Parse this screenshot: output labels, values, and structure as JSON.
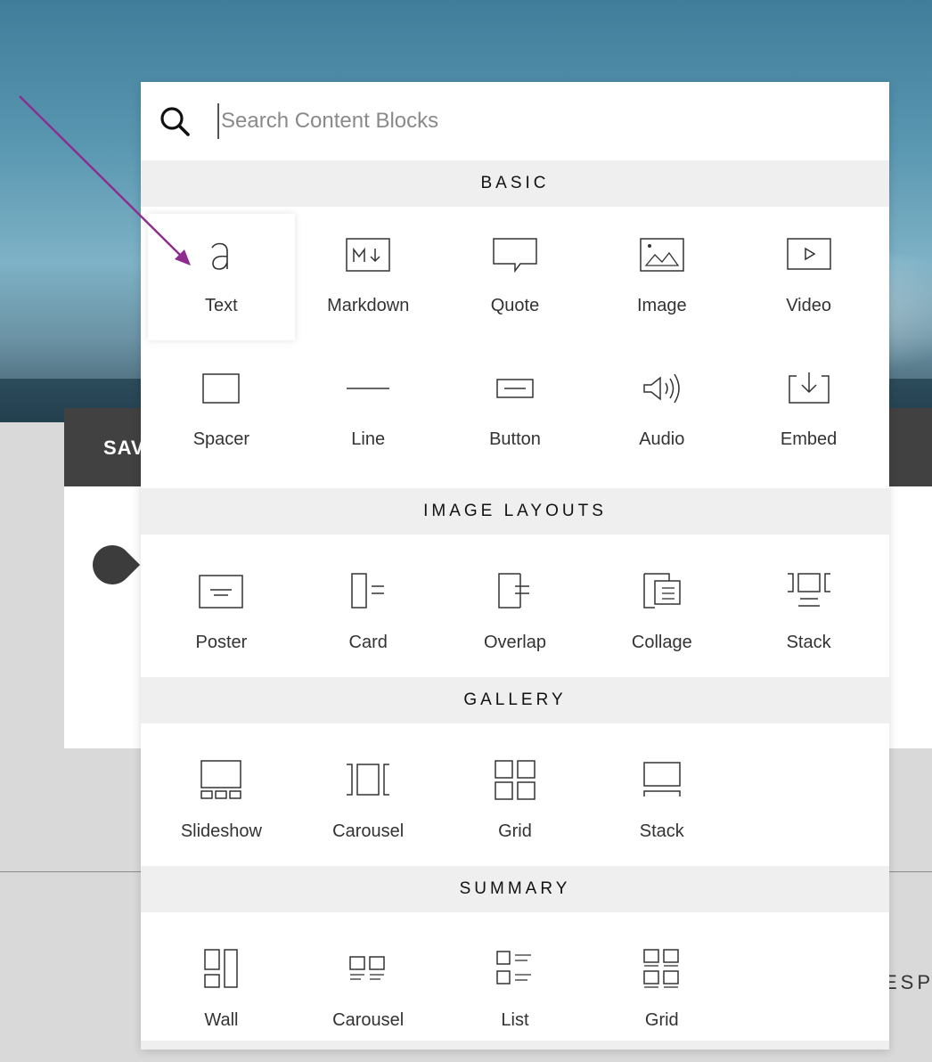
{
  "background": {
    "bar_text": "SAV",
    "right_text": "ESPA"
  },
  "search": {
    "placeholder": "Search Content Blocks",
    "value": ""
  },
  "sections": {
    "basic": {
      "title": "BASIC",
      "items": [
        {
          "label": "Text",
          "icon": "text-icon"
        },
        {
          "label": "Markdown",
          "icon": "markdown-icon"
        },
        {
          "label": "Quote",
          "icon": "quote-icon"
        },
        {
          "label": "Image",
          "icon": "image-icon"
        },
        {
          "label": "Video",
          "icon": "video-icon"
        },
        {
          "label": "Spacer",
          "icon": "spacer-icon"
        },
        {
          "label": "Line",
          "icon": "line-icon"
        },
        {
          "label": "Button",
          "icon": "button-icon"
        },
        {
          "label": "Audio",
          "icon": "audio-icon"
        },
        {
          "label": "Embed",
          "icon": "embed-icon"
        }
      ]
    },
    "image_layouts": {
      "title": "IMAGE LAYOUTS",
      "items": [
        {
          "label": "Poster",
          "icon": "poster-icon"
        },
        {
          "label": "Card",
          "icon": "card-icon"
        },
        {
          "label": "Overlap",
          "icon": "overlap-icon"
        },
        {
          "label": "Collage",
          "icon": "collage-icon"
        },
        {
          "label": "Stack",
          "icon": "stack-icon"
        }
      ]
    },
    "gallery": {
      "title": "GALLERY",
      "items": [
        {
          "label": "Slideshow",
          "icon": "slideshow-icon"
        },
        {
          "label": "Carousel",
          "icon": "carousel-icon"
        },
        {
          "label": "Grid",
          "icon": "grid-icon"
        },
        {
          "label": "Stack",
          "icon": "stack-gallery-icon"
        }
      ]
    },
    "summary": {
      "title": "SUMMARY",
      "items": [
        {
          "label": "Wall",
          "icon": "wall-icon"
        },
        {
          "label": "Carousel",
          "icon": "summary-carousel-icon"
        },
        {
          "label": "List",
          "icon": "list-icon"
        },
        {
          "label": "Grid",
          "icon": "summary-grid-icon"
        }
      ]
    }
  },
  "colors": {
    "annotation_arrow": "#8e2b8e",
    "icon_stroke": "#333333",
    "section_header_bg": "#efefef"
  }
}
